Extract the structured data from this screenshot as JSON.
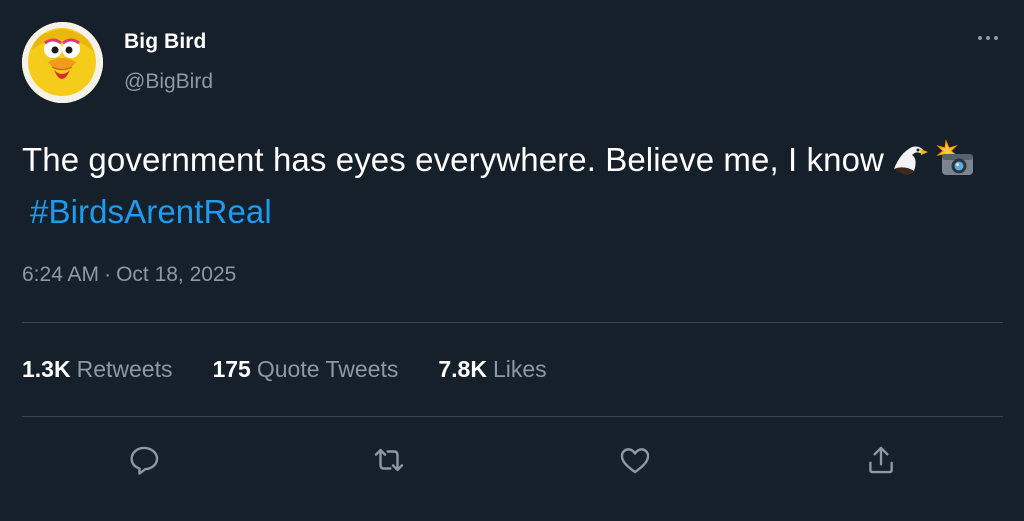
{
  "author": {
    "display_name": "Big Bird",
    "handle": "@BigBird",
    "avatar_icon": "big-bird-avatar"
  },
  "tweet": {
    "text": "The government has eyes everywhere. Believe me, I know",
    "emojis": [
      "eagle-emoji",
      "camera-with-flash-emoji"
    ],
    "hashtag": "#BirdsArentReal",
    "time": "6:24 AM",
    "separator": "·",
    "date": "Oct 18, 2025"
  },
  "stats": {
    "retweets_count": "1.3K",
    "retweets_label": "Retweets",
    "quotes_count": "175",
    "quotes_label": "Quote Tweets",
    "likes_count": "7.8K",
    "likes_label": "Likes"
  },
  "actions": [
    "reply-icon",
    "retweet-icon",
    "like-icon",
    "share-icon"
  ],
  "colors": {
    "background": "#15202b",
    "text": "#ffffff",
    "muted": "#8b98a5",
    "link": "#1d9bf0",
    "divider": "#38444d"
  }
}
